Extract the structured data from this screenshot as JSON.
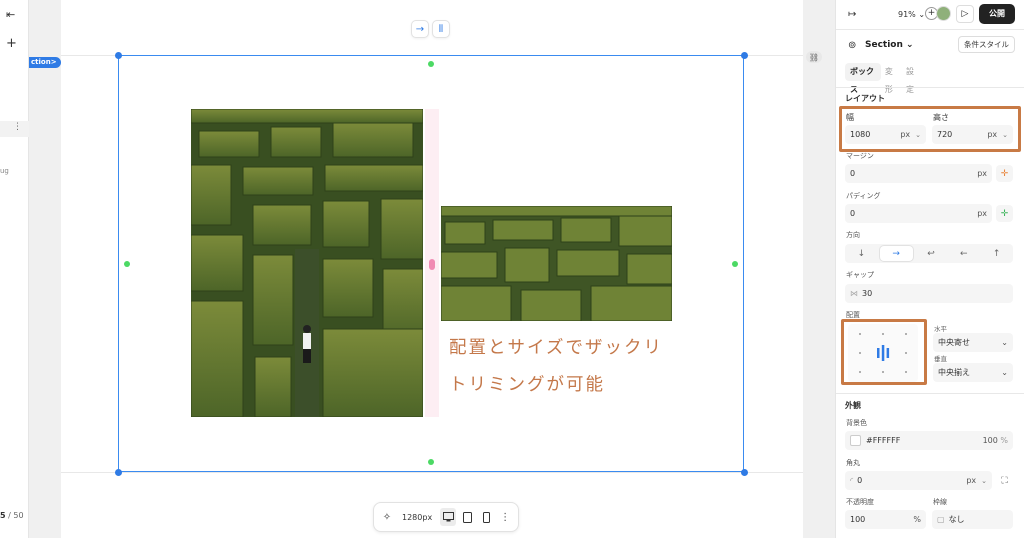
{
  "left": {
    "collapse_icon": "arrow-left-to-line",
    "add_icon": "plus",
    "row_menu": "⋮",
    "ug_text": "ug",
    "pager_current": "5",
    "pager_total": "/ 50"
  },
  "canvas": {
    "section_tag": "ction>",
    "move_tools": [
      "→",
      "⦀"
    ],
    "caption_line1": "配置とサイズでザックリ",
    "caption_line2": "トリミングが可能",
    "bottom": {
      "preset": "1280px"
    },
    "link_icon": "link"
  },
  "panel": {
    "topbar": {
      "zoom": "91%",
      "publish": "公開"
    },
    "element": "Section",
    "cond_style": "条件スタイル",
    "tabs": [
      "ボックス",
      "変形",
      "設定"
    ],
    "layout": {
      "heading": "レイアウト",
      "width_label": "幅",
      "width_value": "1080",
      "width_unit": "px",
      "height_label": "高さ",
      "height_value": "720",
      "height_unit": "px",
      "margin_label": "マージン",
      "margin_value": "0",
      "margin_unit": "px",
      "padding_label": "パディング",
      "padding_value": "0",
      "padding_unit": "px",
      "direction_label": "方向",
      "directions": [
        "↓",
        "→",
        "↩",
        "←",
        "↑"
      ],
      "gap_label": "ギャップ",
      "gap_value": "30",
      "align_label": "配置",
      "horizontal_label": "水平",
      "horizontal_value": "中央寄せ",
      "vertical_label": "垂直",
      "vertical_value": "中央揃え"
    },
    "appearance": {
      "heading": "外観",
      "bg_label": "背景色",
      "bg_value": "#FFFFFF",
      "bg_opacity": "100",
      "bg_opacity_unit": "%",
      "radius_label": "角丸",
      "radius_value": "0",
      "radius_unit": "px",
      "opacity_label": "不透明度",
      "opacity_value": "100",
      "opacity_unit": "%",
      "border_label": "枠線",
      "border_value": "なし"
    }
  },
  "colors": {
    "accent": "#2f7be5",
    "highlight": "#c87a45",
    "caption": "#c4784a"
  }
}
